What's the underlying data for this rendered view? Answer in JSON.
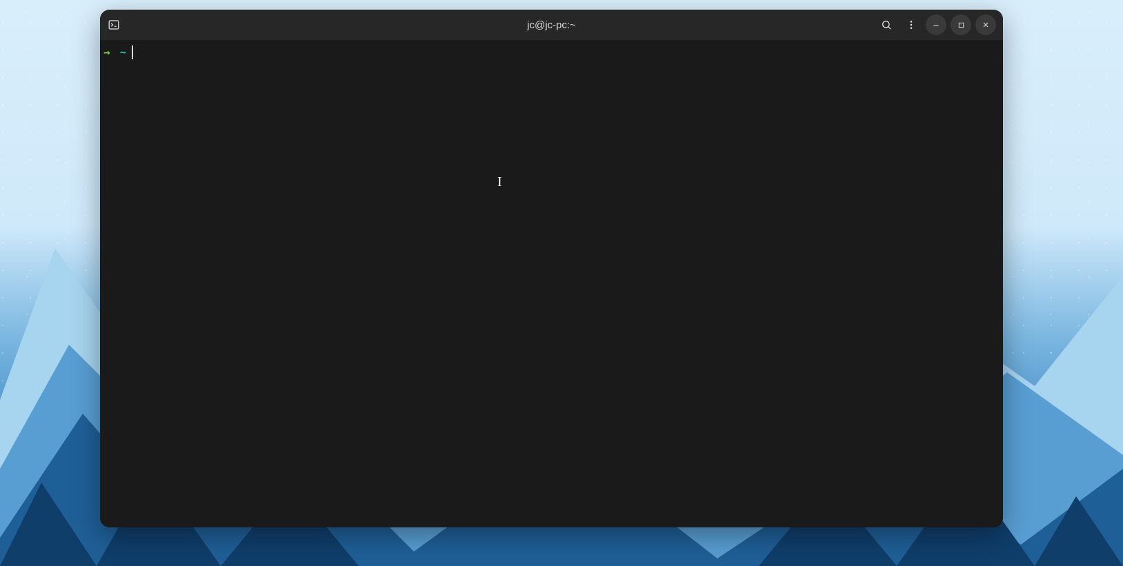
{
  "window": {
    "title": "jc@jc-pc:~"
  },
  "prompt": {
    "arrow": "→",
    "cwd": "~",
    "input": ""
  },
  "icons": {
    "app": "terminal-icon",
    "search": "search-icon",
    "menu": "kebab-menu-icon",
    "minimize": "minimize-icon",
    "maximize": "maximize-icon",
    "close": "close-icon"
  },
  "colors": {
    "accent_green": "#7ec94c",
    "accent_teal": "#2fb8c2",
    "titlebar_bg": "#272727",
    "terminal_bg": "#1a1a1a"
  }
}
